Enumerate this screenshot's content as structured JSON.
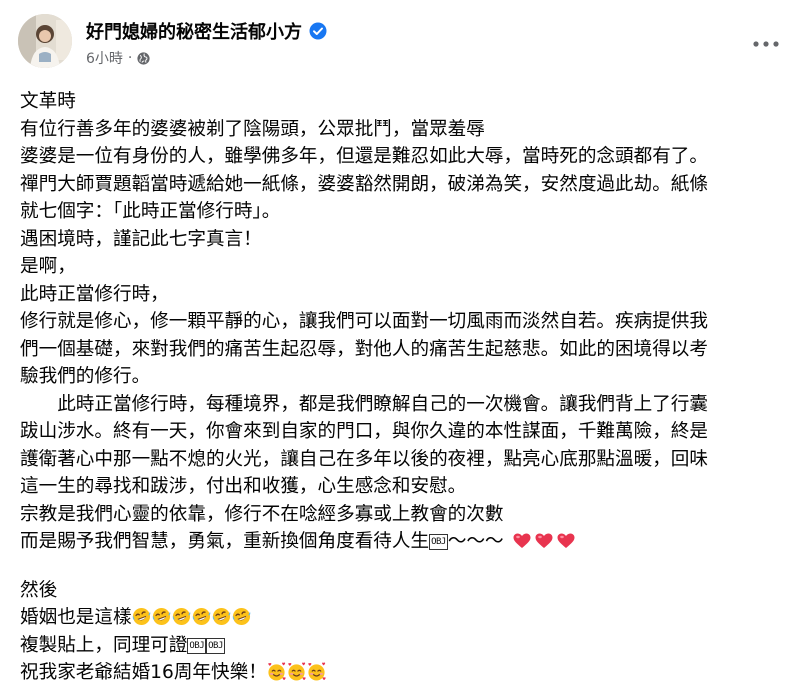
{
  "post": {
    "author": "好門媳婦的秘密生活郁小方",
    "timestamp": "6小時",
    "separator": "·",
    "privacy_icon": "globe-icon",
    "verified_icon": "verified-badge-icon",
    "more_icon": "more-options-icon"
  },
  "content": {
    "l1": "文革時",
    "l2": "有位行善多年的婆婆被剃了陰陽頭，公眾批鬥，當眾羞辱",
    "l3": "婆婆是一位有身份的人，雖學佛多年，但還是難忍如此大辱，當時死的念頭都有了。",
    "l4": "禪門大師賈題韜當時遞給她一紙條，婆婆豁然開朗，破涕為笑，安然度過此劫。紙條",
    "l5": "就七個字：「此時正當修行時」。",
    "l6": "遇困境時，謹記此七字真言！",
    "l7": "是啊，",
    "l8": "此時正當修行時，",
    "l9": "修行就是修心，修一顆平靜的心，讓我們可以面對一切風雨而淡然自若。疾病提供我",
    "l10": "們一個基礎，來對我們的痛苦生起忍辱，對他人的痛苦生起慈悲。如此的困境得以考",
    "l11": "驗我們的修行。",
    "l12": "　　此時正當修行時，每種境界，都是我們瞭解自己的一次機會。讓我們背上了行囊",
    "l13": "跋山涉水。終有一天，你會來到自家的門口，與你久違的本性謀面，千難萬險，終是",
    "l14": "護衛著心中那一點不熄的火光，讓自己在多年以後的夜裡，點亮心底那點溫暖，回味",
    "l15": "這一生的尋找和跋涉，付出和收獲，心生感念和安慰。",
    "l16": "宗教是我們心靈的依靠，修行不在唸經多寡或上教會的次數",
    "l17": "而是賜予我們智慧，勇氣，重新換個角度看待人生",
    "l17_obj": "OBJ",
    "l17_tail": "～～～",
    "l18": "然後",
    "l19": "婚姻也是這樣",
    "l20": "複製貼上，同理可證",
    "l20_obj1": "OBJ",
    "l20_obj2": "OBJ",
    "l21": "祝我家老爺結婚16周年快樂！"
  },
  "emoji": {
    "heart": "heart-emoji",
    "laugh": "rolling-laughing-emoji",
    "love": "smiling-face-hearts-emoji"
  },
  "colors": {
    "text": "#050505",
    "secondary": "#65676b",
    "verified": "#1877f2",
    "heart": "#e8344f",
    "emoji_yellow": "#fcc21b"
  }
}
